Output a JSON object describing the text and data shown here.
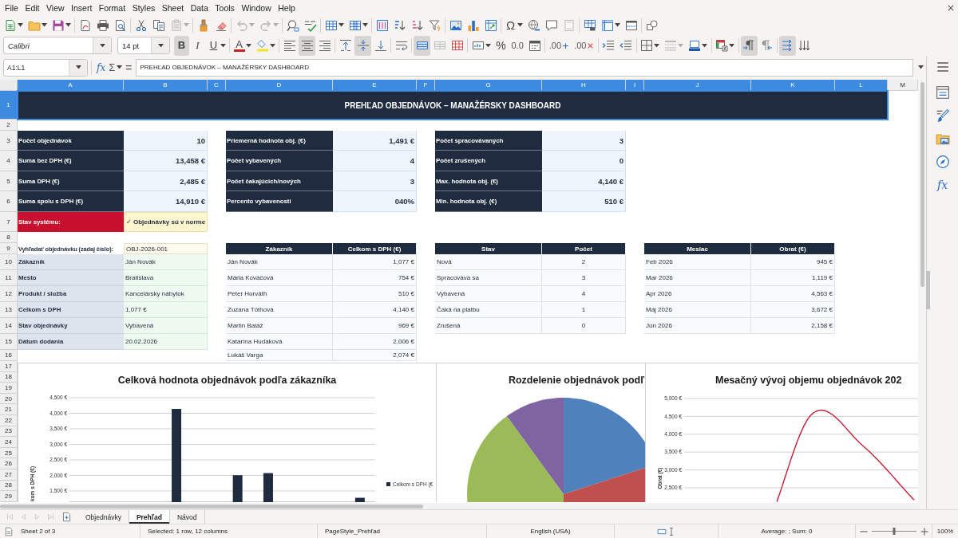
{
  "menu": [
    "File",
    "Edit",
    "View",
    "Insert",
    "Format",
    "Styles",
    "Sheet",
    "Data",
    "Tools",
    "Window",
    "Help"
  ],
  "toolbar_standard": [
    {
      "kind": "split",
      "disabled": false
    },
    {
      "kind": "split",
      "disabled": false
    },
    {
      "kind": "split",
      "disabled": false
    },
    {
      "kind": "button",
      "disabled": false
    },
    {
      "kind": "button",
      "disabled": false
    },
    {
      "kind": "button",
      "disabled": false
    },
    {
      "kind": "button",
      "disabled": false
    },
    {
      "kind": "button",
      "disabled": false
    },
    {
      "kind": "split",
      "disabled": true
    },
    {
      "kind": "button",
      "disabled": false
    },
    {
      "kind": "button",
      "disabled": false
    },
    {
      "kind": "split",
      "disabled": true
    },
    {
      "kind": "split",
      "disabled": true
    },
    {
      "kind": "button",
      "disabled": false
    },
    {
      "kind": "button",
      "disabled": false
    },
    {
      "kind": "split",
      "disabled": false
    },
    {
      "kind": "split",
      "disabled": false
    },
    {
      "kind": "button",
      "disabled": false
    },
    {
      "kind": "button",
      "disabled": false
    },
    {
      "kind": "button",
      "disabled": false
    },
    {
      "kind": "button",
      "disabled": false
    },
    {
      "kind": "button",
      "disabled": false
    },
    {
      "kind": "button",
      "disabled": false
    },
    {
      "kind": "button",
      "disabled": false
    },
    {
      "kind": "split",
      "label": "Ω",
      "disabled": false
    },
    {
      "kind": "button",
      "disabled": false
    },
    {
      "kind": "button",
      "disabled": false
    },
    {
      "kind": "button",
      "disabled": true
    },
    {
      "kind": "button",
      "disabled": false
    },
    {
      "kind": "split",
      "disabled": false
    },
    {
      "kind": "button",
      "disabled": false
    },
    {
      "kind": "button",
      "disabled": false
    }
  ],
  "toolbar_formatting": {
    "font_name": "Calibri",
    "font_size": "14 pt",
    "buttons": [
      {
        "kind": "button",
        "label": "B",
        "pressed": true,
        "disabled": false
      },
      {
        "kind": "button",
        "label": "I",
        "pressed": false,
        "disabled": false
      },
      {
        "kind": "split",
        "label": "U",
        "pressed": false,
        "disabled": false
      },
      {
        "kind": "split",
        "label": "A",
        "pressed": false,
        "disabled": false
      },
      {
        "kind": "split",
        "pressed": false,
        "disabled": false
      },
      {
        "kind": "button",
        "pressed": false,
        "disabled": false
      },
      {
        "kind": "button",
        "pressed": true,
        "disabled": false
      },
      {
        "kind": "button",
        "pressed": false,
        "disabled": false
      },
      {
        "kind": "button",
        "pressed": false,
        "disabled": false
      },
      {
        "kind": "button",
        "pressed": true,
        "disabled": false
      },
      {
        "kind": "button",
        "pressed": false,
        "disabled": false
      },
      {
        "kind": "button",
        "pressed": false,
        "disabled": false
      },
      {
        "kind": "button",
        "pressed": true,
        "disabled": false
      },
      {
        "kind": "button",
        "pressed": false,
        "disabled": true
      },
      {
        "kind": "button",
        "pressed": false,
        "disabled": false
      },
      {
        "kind": "split",
        "pressed": false,
        "disabled": false
      },
      {
        "kind": "button",
        "label": "%",
        "pressed": false,
        "disabled": false
      },
      {
        "kind": "button",
        "label": "0.0",
        "pressed": false,
        "disabled": false
      },
      {
        "kind": "button",
        "pressed": false,
        "disabled": false
      },
      {
        "kind": "button",
        "label": ".00",
        "pressed": false,
        "disabled": false
      },
      {
        "kind": "button",
        "label": ".00",
        "pressed": false,
        "disabled": false
      },
      {
        "kind": "button",
        "pressed": false,
        "disabled": false
      },
      {
        "kind": "button",
        "pressed": false,
        "disabled": false
      },
      {
        "kind": "split",
        "pressed": false,
        "disabled": false
      },
      {
        "kind": "split",
        "pressed": false,
        "disabled": true
      },
      {
        "kind": "split",
        "pressed": false,
        "disabled": false
      },
      {
        "kind": "split",
        "pressed": false,
        "disabled": false
      },
      {
        "kind": "button",
        "pressed": true,
        "disabled": false
      },
      {
        "kind": "button",
        "pressed": false,
        "disabled": false
      },
      {
        "kind": "button",
        "pressed": true,
        "disabled": false
      },
      {
        "kind": "button",
        "pressed": false,
        "disabled": false
      }
    ]
  },
  "formula_bar": {
    "name_box": "A1:L1",
    "function_wizard": "fx",
    "sum": "Σ",
    "equals": "=",
    "content": "PREHĽAD OBJEDNÁVOK – MANAŽÉRSKY DASHBOARD"
  },
  "sidebar": {
    "functions_label": "fx"
  },
  "sheet": {
    "columns": [
      {
        "label": "A",
        "selected": true
      },
      {
        "label": "B",
        "selected": true
      },
      {
        "label": "C",
        "selected": true
      },
      {
        "label": "D",
        "selected": true
      },
      {
        "label": "E",
        "selected": true
      },
      {
        "label": "F",
        "selected": true
      },
      {
        "label": "G",
        "selected": true
      },
      {
        "label": "H",
        "selected": true
      },
      {
        "label": "I",
        "selected": true
      },
      {
        "label": "J",
        "selected": true
      },
      {
        "label": "K",
        "selected": true
      },
      {
        "label": "L",
        "selected": true
      },
      {
        "label": "M",
        "selected": false
      }
    ],
    "rows": [
      {
        "label": "1",
        "selected": true
      },
      {
        "label": "2",
        "selected": false
      },
      {
        "label": "3",
        "selected": false
      },
      {
        "label": "4",
        "selected": false
      },
      {
        "label": "5",
        "selected": false
      },
      {
        "label": "6",
        "selected": false
      },
      {
        "label": "7",
        "selected": false
      },
      {
        "label": "8",
        "selected": false
      },
      {
        "label": "9",
        "selected": false
      },
      {
        "label": "10",
        "selected": false
      },
      {
        "label": "11",
        "selected": false
      },
      {
        "label": "12",
        "selected": false
      },
      {
        "label": "13",
        "selected": false
      },
      {
        "label": "14",
        "selected": false
      },
      {
        "label": "15",
        "selected": false
      },
      {
        "label": "16",
        "selected": false
      },
      {
        "label": "17",
        "selected": false
      },
      {
        "label": "18",
        "selected": false
      },
      {
        "label": "19",
        "selected": false
      },
      {
        "label": "20",
        "selected": false
      },
      {
        "label": "21",
        "selected": false
      },
      {
        "label": "22",
        "selected": false
      },
      {
        "label": "23",
        "selected": false
      },
      {
        "label": "24",
        "selected": false
      },
      {
        "label": "25",
        "selected": false
      },
      {
        "label": "26",
        "selected": false
      },
      {
        "label": "27",
        "selected": false
      },
      {
        "label": "28",
        "selected": false
      },
      {
        "label": "29",
        "selected": false
      }
    ],
    "title": {
      "text": "PREHĽAD OBJEDNÁVOK – MANAŽÉRSKY DASHBOARD",
      "selected": true
    },
    "kpi_blocks": [
      {
        "items": [
          {
            "label": "Počet objednávok",
            "value": "10"
          },
          {
            "label": "Suma bez DPH (€)",
            "value": "13,458 €"
          },
          {
            "label": "Suma DPH (€)",
            "value": "2,485 €"
          },
          {
            "label": "Suma spolu s DPH (€)",
            "value": "14,910 €"
          }
        ]
      },
      {
        "items": [
          {
            "label": "Priemerná hodnota obj. (€)",
            "value": "1,491 €"
          },
          {
            "label": "Počet vybavených",
            "value": "4"
          },
          {
            "label": "Počet čakajúcich/nových",
            "value": "3"
          },
          {
            "label": "Percento vybavenosti",
            "value": "040%"
          }
        ]
      },
      {
        "items": [
          {
            "label": "Počet spracovávaných",
            "value": "3"
          },
          {
            "label": "Počet zrušených",
            "value": "0"
          },
          {
            "label": "Max. hodnota obj. (€)",
            "value": "4,140 €"
          },
          {
            "label": "Min. hodnota obj. (€)",
            "value": "510 €"
          }
        ]
      }
    ],
    "system_status": {
      "label": "Stav systému:",
      "value": "✓ Objednávky sú v norme"
    },
    "lookup": {
      "prompt": "Vyhľadať objednávku (zadaj číslo):",
      "query": "OBJ-2026-001",
      "fields": [
        {
          "label": "Zákazník",
          "value": "Ján Novák"
        },
        {
          "label": "Mesto",
          "value": "Bratislava"
        },
        {
          "label": "Produkt / služba",
          "value": "Kancelársky nábytok"
        },
        {
          "label": "Celkom s DPH",
          "value": "1,077 €"
        },
        {
          "label": "Stav objednávky",
          "value": "Vybavená"
        },
        {
          "label": "Dátum dodania",
          "value": "20.02.2026"
        }
      ]
    },
    "tables": [
      {
        "columns": [
          "Zákazník",
          "Celkom s DPH (€)"
        ],
        "rows": [
          [
            "Ján Novák",
            "1,077 €"
          ],
          [
            "Mária Kováčová",
            "754 €"
          ],
          [
            "Peter Horváth",
            "510 €"
          ],
          [
            "Zuzana Tóthová",
            "4,140 €"
          ],
          [
            "Martin Baláž",
            "969 €"
          ],
          [
            "Katarína Hudáková",
            "2,006 €"
          ],
          [
            "Lukáš Varga",
            "2,074 €"
          ]
        ]
      },
      {
        "columns": [
          "Stav",
          "Počet"
        ],
        "rows": [
          [
            "Nová",
            "2"
          ],
          [
            "Spracováva sa",
            "3"
          ],
          [
            "Vybavená",
            "4"
          ],
          [
            "Čaká na platbu",
            "1"
          ],
          [
            "Zrušená",
            "0"
          ]
        ]
      },
      {
        "columns": [
          "Mesiac",
          "Obrat (€)"
        ],
        "rows": [
          [
            "Feb 2026",
            "945 €"
          ],
          [
            "Mar 2026",
            "1,119 €"
          ],
          [
            "Apr 2026",
            "4,563 €"
          ],
          [
            "Máj 2026",
            "3,672 €"
          ],
          [
            "Jún 2026",
            "2,158 €"
          ]
        ]
      }
    ]
  },
  "charts": [
    {
      "kind": "chart",
      "chart_data": {
        "type": "bar",
        "title": "Celková hodnota objednávok podľa zákazníka",
        "ylabel": "kom s DPH (€)",
        "ylim": [
          1140,
          4500
        ],
        "grid": true,
        "yticks": [
          {
            "value": 1500,
            "label": "1,500 €"
          },
          {
            "value": 2000,
            "label": "2,000 €"
          },
          {
            "value": 2500,
            "label": "2,500 €"
          },
          {
            "value": 3000,
            "label": "3,000 €"
          },
          {
            "value": 3500,
            "label": "3,500 €"
          },
          {
            "value": 4000,
            "label": "4,000 €"
          },
          {
            "value": 4500,
            "label": "4,500 €"
          }
        ],
        "series": [
          {
            "name": "Celkom s DPH (€",
            "color": "#1f2b3e",
            "values": [
              null,
              null,
              null,
              4140,
              null,
              2006,
              2074,
              null,
              null,
              1280
            ]
          }
        ]
      }
    },
    {
      "kind": "pie",
      "title": "Rozdelenie objednávok podľ"
    },
    {
      "kind": "line",
      "title": "Mesačný vývoj objemu objednávok 202",
      "axis_title": "Obrat (€)",
      "tick_labels": [
        "5,000 €",
        "4,500 €",
        "4,000 €",
        "3,500 €",
        "3,000 €",
        "2,500 €"
      ]
    }
  ],
  "sheet_tabs": {
    "navigation": [
      {
        "disabled": true
      },
      {
        "disabled": true
      },
      {
        "disabled": true
      },
      {
        "disabled": true
      }
    ],
    "tabs": [
      {
        "label": "Objednávky",
        "selected": false
      },
      {
        "label": "Prehľad",
        "selected": true
      },
      {
        "label": "Návod",
        "selected": false
      }
    ]
  },
  "status_bar": {
    "sheet": "Sheet 2 of 3",
    "selection": "Selected: 1 row, 12 columns",
    "page_style": "PageStyle_Prehľad",
    "language": "English (USA)",
    "summary": "Average: ; Sum: 0",
    "zoom_slider": {
      "level": 0.5
    },
    "zoom": "100%"
  }
}
